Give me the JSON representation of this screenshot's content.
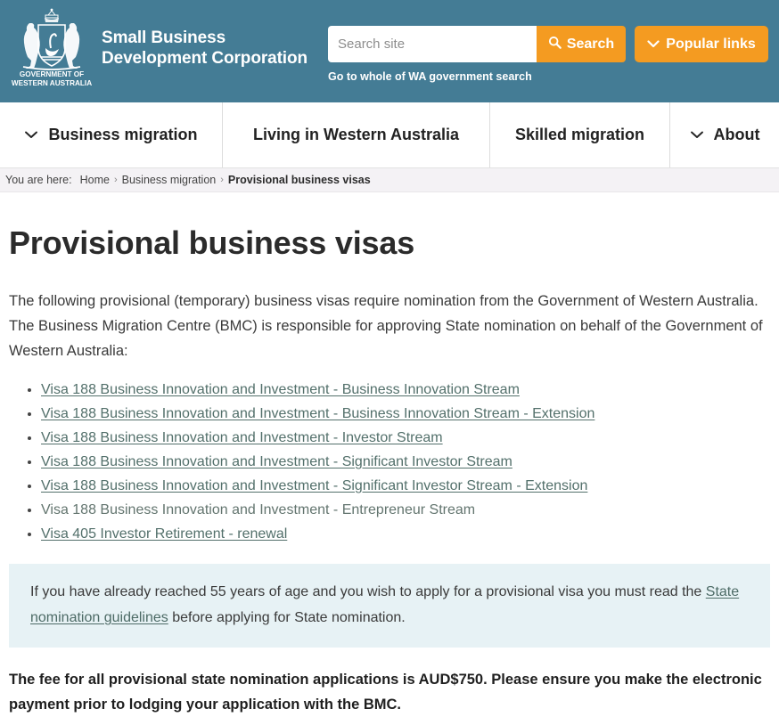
{
  "header": {
    "crest_line1": "GOVERNMENT OF",
    "crest_line2": "WESTERN AUSTRALIA",
    "brand_line1": "Small Business",
    "brand_line2": "Development Corporation",
    "search": {
      "placeholder": "Search site",
      "value": "",
      "button_label": "Search",
      "search_icon": "search-icon"
    },
    "popular_links": {
      "label": "Popular links",
      "icon": "chevron-down-icon"
    },
    "wa_search_link": "Go to whole of WA government search",
    "colors": {
      "header_bg": "#447C95",
      "accent_orange": "#F49B21"
    }
  },
  "nav": {
    "items": [
      {
        "label": "Business migration",
        "has_chevron": true,
        "icon": "chevron-down-icon"
      },
      {
        "label": "Living in Western Australia",
        "has_chevron": false,
        "icon": ""
      },
      {
        "label": "Skilled migration",
        "has_chevron": false,
        "icon": ""
      },
      {
        "label": "About",
        "has_chevron": true,
        "icon": "chevron-down-icon"
      }
    ]
  },
  "breadcrumb": {
    "prefix": "You are here:",
    "items": [
      {
        "label": "Home",
        "current": false
      },
      {
        "label": "Business migration",
        "current": false
      },
      {
        "label": "Provisional business visas",
        "current": true
      }
    ],
    "separator": "›"
  },
  "main": {
    "title": "Provisional business visas",
    "intro": "The following provisional (temporary) business visas require nomination from the Government of Western Australia. The Business Migration Centre (BMC) is responsible for approving State nomination on behalf of the Government of Western Australia:",
    "visa_list": [
      {
        "label": "Visa 188 Business Innovation and Investment - Business Innovation Stream",
        "is_link": true
      },
      {
        "label": "Visa 188 Business Innovation and Investment - Business Innovation Stream - Extension",
        "is_link": true
      },
      {
        "label": "Visa 188 Business Innovation and Investment - Investor Stream",
        "is_link": true
      },
      {
        "label": "Visa 188 Business Innovation and Investment - Significant Investor Stream",
        "is_link": true
      },
      {
        "label": "Visa 188 Business Innovation and Investment - Significant Investor Stream - Extension",
        "is_link": true
      },
      {
        "label": "Visa 188 Business Innovation and Investment - Entrepreneur Stream",
        "is_link": false
      },
      {
        "label": "Visa 405 Investor Retirement - renewal",
        "is_link": true
      }
    ],
    "callout": {
      "text_before": "If you have already reached 55 years of age and you wish to apply for a provisional visa you must read the ",
      "link_text": "State nomination guidelines",
      "text_after": " before applying for State nomination.",
      "bg_color": "#E7F2F5"
    },
    "fee_note": "The fee for all provisional state nomination applications is AUD$750. Please ensure you make the electronic payment prior to lodging your application with the BMC."
  }
}
